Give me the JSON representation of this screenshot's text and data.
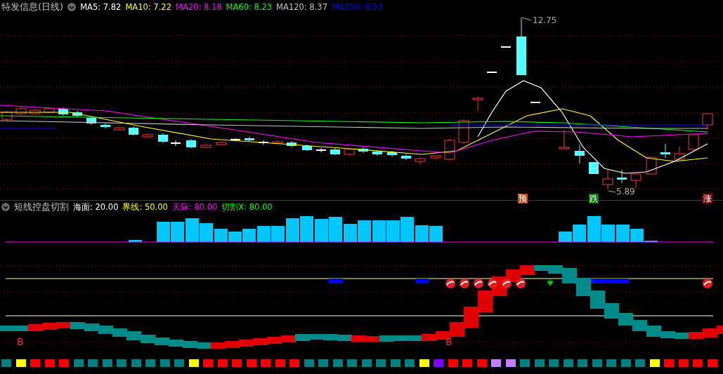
{
  "main_chart": {
    "title": "特发信息(日线)",
    "moving_averages": [
      {
        "label": "MA5: 7.82",
        "color": "#ffffff"
      },
      {
        "label": "MA10: 7.22",
        "color": "#ffff00"
      },
      {
        "label": "MA20: 8.18",
        "color": "#ff00ff"
      },
      {
        "label": "MA60: 8.23",
        "color": "#00ff00"
      },
      {
        "label": "MA120: 8.37",
        "color": "#c0c0c0"
      },
      {
        "label": "MA250: 8.53",
        "color": "#0000ff"
      }
    ],
    "high_label": "12.75",
    "low_label": "5.89",
    "signals": [
      {
        "text": "预",
        "kind": "warn"
      },
      {
        "text": "跌",
        "kind": "down"
      },
      {
        "text": "涨",
        "kind": "up"
      }
    ]
  },
  "indicator": {
    "title": "短线控盘切割",
    "params": [
      {
        "label": "海面: 20.00",
        "color": "#ffffff"
      },
      {
        "label": "界线: 50.00",
        "color": "#ffff00"
      },
      {
        "label": "天际: 80.00",
        "color": "#ff00ff"
      },
      {
        "label": "切割X: 80.00",
        "color": "#00ff00"
      }
    ],
    "buy_marks": [
      "B",
      "B"
    ]
  },
  "squares": [
    {
      "color": "#008080"
    },
    {
      "color": "#ffff00"
    },
    {
      "color": "#ff0000"
    },
    {
      "color": "#ff0000"
    },
    {
      "color": "#ff0000"
    },
    {
      "color": "#008080"
    },
    {
      "color": "#008080"
    },
    {
      "color": "#008080"
    },
    {
      "color": "#008080"
    },
    {
      "color": "#008080"
    },
    {
      "color": "#008080"
    },
    {
      "color": "#008080"
    },
    {
      "color": "#008080"
    },
    {
      "color": "#ffff00"
    },
    {
      "color": "#ff0000"
    },
    {
      "color": "#ff0000"
    },
    {
      "color": "#ff0000"
    },
    {
      "color": "#ff0000"
    },
    {
      "color": "#ff0000"
    },
    {
      "color": "#ff0000"
    },
    {
      "color": "#ff0000"
    },
    {
      "color": "#008080"
    },
    {
      "color": "#008080"
    },
    {
      "color": "#008080"
    },
    {
      "color": "#008080"
    },
    {
      "color": "#008080"
    },
    {
      "color": "#008080"
    },
    {
      "color": "#008080"
    },
    {
      "color": "#008080"
    },
    {
      "color": "#ffff00"
    },
    {
      "color": "#8000ff"
    },
    {
      "color": "#ff0000"
    },
    {
      "color": "#ff0000"
    },
    {
      "color": "#ff0000"
    },
    {
      "color": "#c080ff"
    },
    {
      "color": "#c080ff"
    },
    {
      "color": "#008080"
    },
    {
      "color": "#008080"
    },
    {
      "color": "#008080"
    },
    {
      "color": "#008080"
    },
    {
      "color": "#008080"
    },
    {
      "color": "#008080"
    },
    {
      "color": "#008080"
    },
    {
      "color": "#008080"
    },
    {
      "color": "#008080"
    },
    {
      "color": "#ffff00"
    },
    {
      "color": "#ff0000"
    },
    {
      "color": "#ff0000"
    },
    {
      "color": "#ff0000"
    },
    {
      "color": "#ff0000"
    }
  ]
}
